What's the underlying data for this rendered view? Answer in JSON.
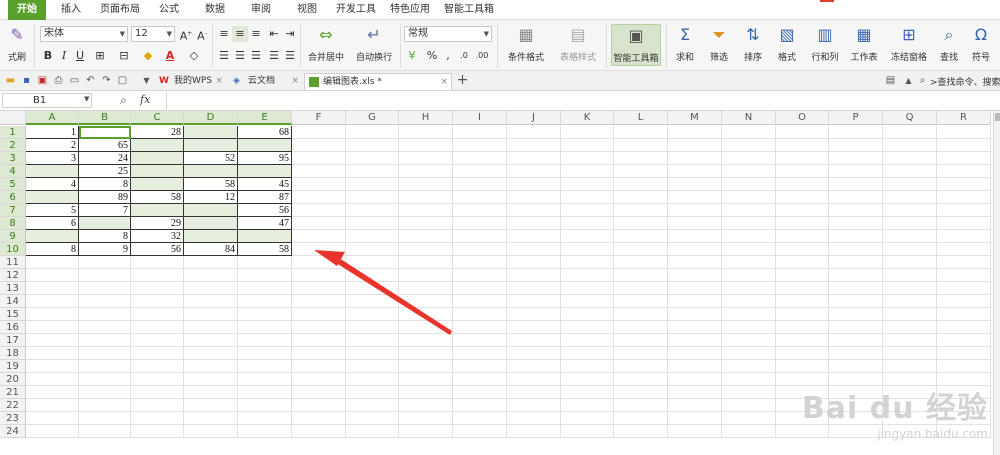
{
  "menu": {
    "tabs": [
      {
        "label": "开始",
        "active": true
      },
      {
        "label": "插入"
      },
      {
        "label": "页面布局"
      },
      {
        "label": "公式"
      },
      {
        "label": "数据"
      },
      {
        "label": "审阅"
      },
      {
        "label": "视图"
      },
      {
        "label": "开发工具"
      },
      {
        "label": "特色应用"
      },
      {
        "label": "智能工具箱"
      }
    ]
  },
  "ribbon": {
    "format_painter_label": "式刷",
    "font_name": "宋体",
    "font_size": "12",
    "merge_label": "合并居中",
    "wrap_label": "自动换行",
    "number_format": "常规",
    "percent": "%",
    "comma": ",",
    "cond_format_label": "条件格式",
    "table_style_label": "表格样式",
    "smart_toolbox_label": "智能工具箱",
    "sum_label": "求和",
    "filter_label": "筛选",
    "sort_label": "排序",
    "format_label": "格式",
    "rowcol_label": "行和列",
    "sheet_label": "工作表",
    "freeze_label": "冻结窗格",
    "find_label": "查找",
    "symbol_label": "符号"
  },
  "docbar": {
    "tabs": [
      {
        "label": "我的WPS"
      },
      {
        "label": "云文档"
      },
      {
        "label": "编辑图表.xls *",
        "active": true
      }
    ],
    "search_placeholder": ">查找命令、搜索..."
  },
  "formula": {
    "cell_ref": "B1",
    "fx": "fx"
  },
  "sheet": {
    "columns": [
      "A",
      "B",
      "C",
      "D",
      "E",
      "F",
      "G",
      "H",
      "I",
      "J",
      "K",
      "L",
      "M",
      "N",
      "O",
      "P",
      "Q",
      "R"
    ],
    "rows": [
      "1",
      "2",
      "3",
      "4",
      "5",
      "6",
      "7",
      "8",
      "9",
      "10",
      "11",
      "12",
      "13",
      "14",
      "15",
      "16",
      "17",
      "18",
      "19",
      "20",
      "21",
      "22",
      "23",
      "24"
    ],
    "table": [
      [
        "1",
        "",
        "28",
        "",
        "68"
      ],
      [
        "2",
        "65",
        "",
        "",
        ""
      ],
      [
        "3",
        "24",
        "",
        "52",
        "95"
      ],
      [
        "",
        "25",
        "",
        "",
        ""
      ],
      [
        "4",
        "8",
        "",
        "58",
        "45"
      ],
      [
        "",
        "89",
        "58",
        "12",
        "87"
      ],
      [
        "5",
        "7",
        "",
        "",
        "56"
      ],
      [
        "6",
        "",
        "29",
        "",
        "47"
      ],
      [
        "",
        "8",
        "32",
        "",
        ""
      ],
      [
        "8",
        "9",
        "56",
        "84",
        "58"
      ]
    ],
    "selection_color": "#e6eedd",
    "accent": "#5aa02c"
  },
  "watermark": {
    "line1": "Bai du 经验",
    "line2": "jingyan.baidu.com"
  }
}
